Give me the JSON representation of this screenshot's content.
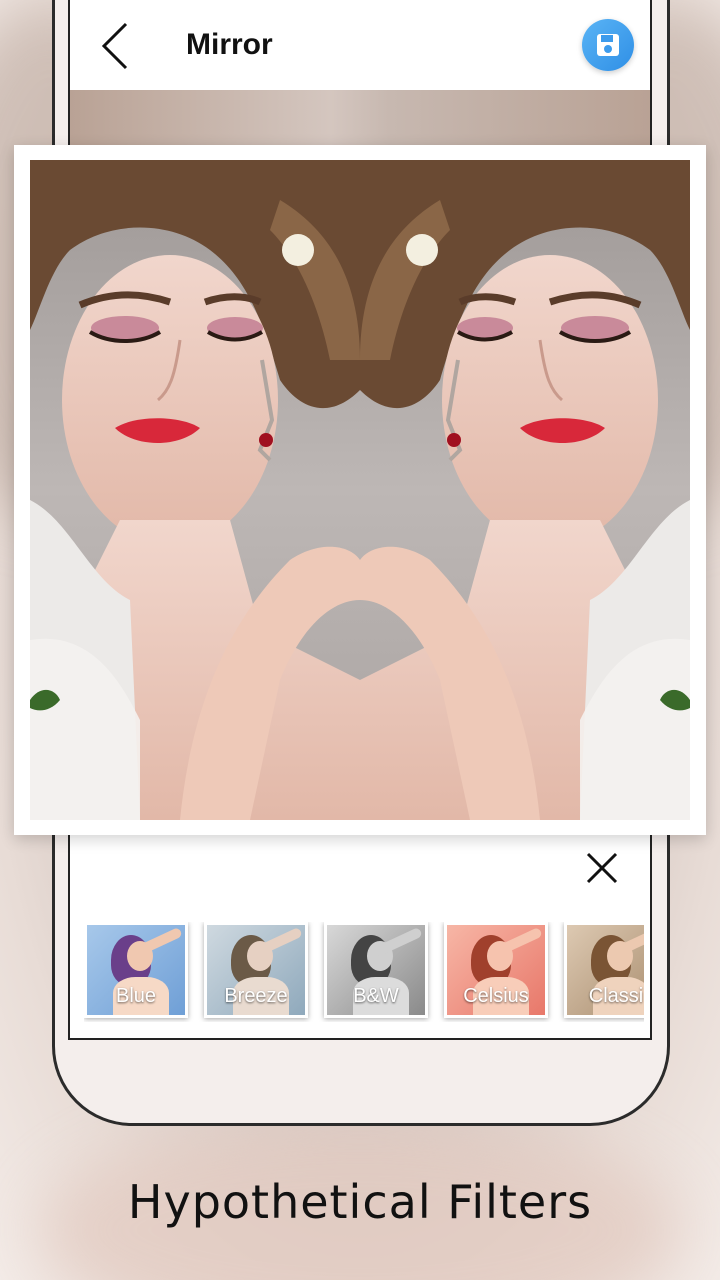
{
  "app": {
    "title": "Mirror",
    "back_icon": "chevron-left-icon",
    "save_icon": "save-icon",
    "accent_color": "#3d9bec"
  },
  "photo": {
    "effect": "mirror"
  },
  "filter_panel": {
    "close_icon": "close-icon",
    "filters": [
      {
        "label": "Blue",
        "tint": "#7fb3e6"
      },
      {
        "label": "Breeze",
        "tint": "#9fb8c9"
      },
      {
        "label": "B&W",
        "tint": "#9a9a9a"
      },
      {
        "label": "Celsius",
        "tint": "#f08a7a"
      },
      {
        "label": "Classi",
        "tint": "#c9a98a"
      }
    ]
  },
  "caption": "Hypothetical Filters"
}
